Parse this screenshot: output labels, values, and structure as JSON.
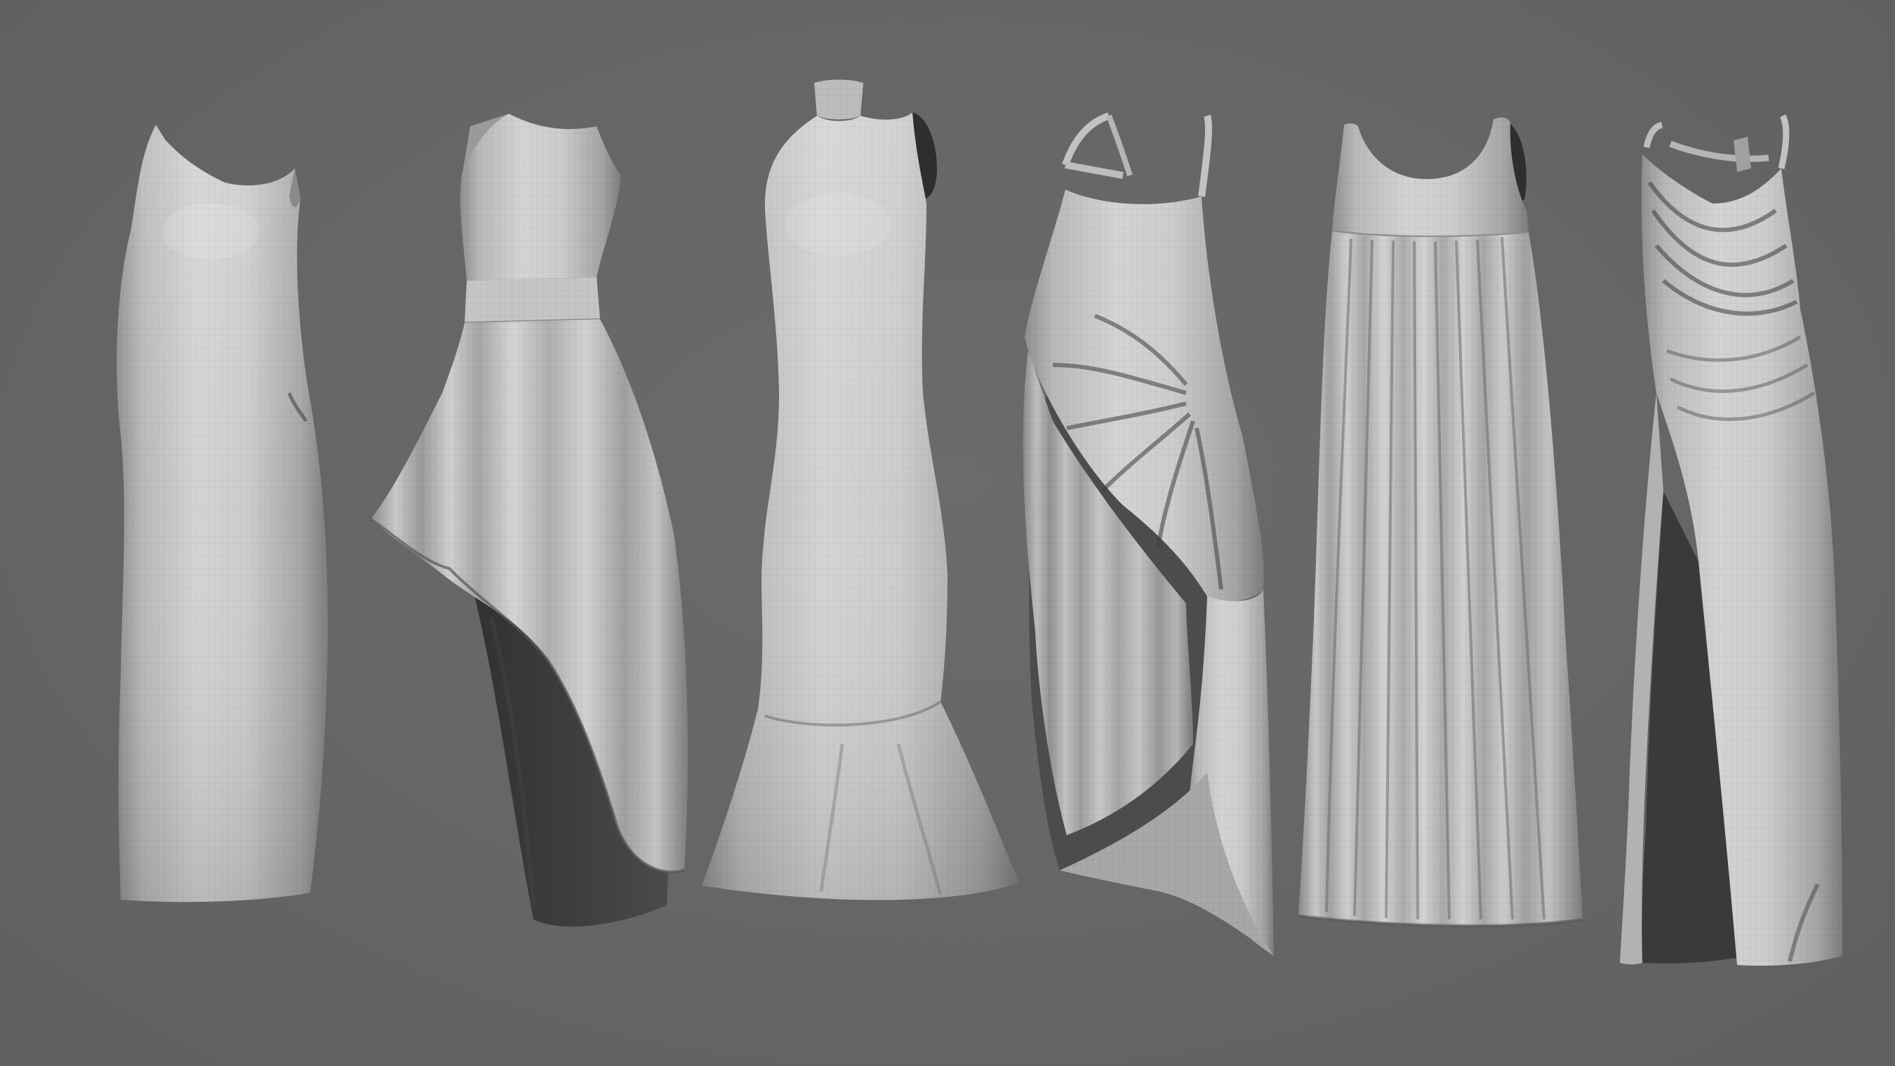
{
  "scene": {
    "background_color": "#666666",
    "garment_color": "#cfcfcf",
    "shadow_color": "#3a3a3a",
    "garments": [
      {
        "name": "one-shoulder-bodycon-dress"
      },
      {
        "name": "one-shoulder-high-low-skirt-dress"
      },
      {
        "name": "sleeveless-mermaid-dress"
      },
      {
        "name": "asymmetric-draped-slip-dress"
      },
      {
        "name": "empire-waist-pleated-maxi-dress"
      },
      {
        "name": "cowl-neck-high-slit-gown"
      }
    ]
  }
}
